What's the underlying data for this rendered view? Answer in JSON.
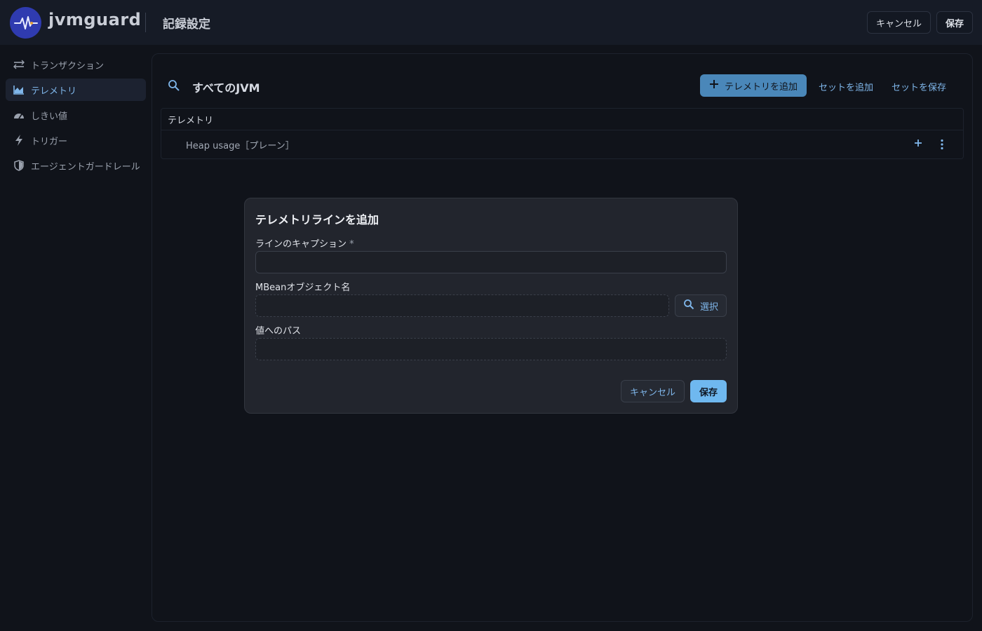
{
  "header": {
    "brand": "jvmguard",
    "page_title": "記録設定",
    "cancel_label": "キャンセル",
    "save_label": "保存"
  },
  "sidebar": {
    "items": [
      {
        "label": "トランザクション",
        "icon": "transactions-icon",
        "active": false
      },
      {
        "label": "テレメトリ",
        "icon": "chart-icon",
        "active": true
      },
      {
        "label": "しきい値",
        "icon": "gauge-icon",
        "active": false
      },
      {
        "label": "トリガー",
        "icon": "bolt-icon",
        "active": false
      },
      {
        "label": "エージェントガードレール",
        "icon": "shield-icon",
        "active": false
      }
    ]
  },
  "main": {
    "scope_title": "すべてのJVM",
    "add_telemetry_label": "テレメトリを追加",
    "add_set_label": "セットを追加",
    "save_set_label": "セットを保存",
    "table": {
      "header": "テレメトリ",
      "rows": [
        {
          "label": "Heap usage［プレーン］"
        }
      ]
    }
  },
  "modal": {
    "title": "テレメトリラインを追加",
    "caption_label": "ラインのキャプション",
    "required_mark": "*",
    "caption_value": "",
    "mbean_label": "MBeanオブジェクト名",
    "mbean_value": "",
    "select_label": "選択",
    "path_label": "値へのパス",
    "path_value": "",
    "cancel_label": "キャンセル",
    "save_label": "保存"
  },
  "colors": {
    "accent": "#7fb6ea",
    "primary_button": "#6fb8ef",
    "logo_bg": "#2f3bb0",
    "background": "#10131a"
  }
}
